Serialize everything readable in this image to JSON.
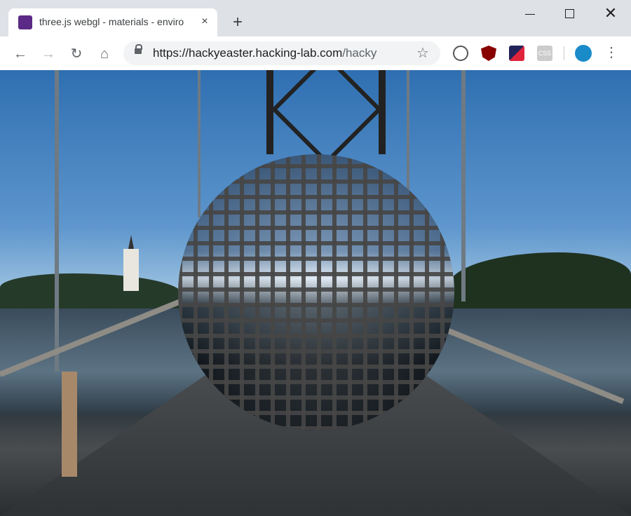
{
  "tab": {
    "title": "three.js webgl - materials - enviro",
    "close_label": "×"
  },
  "newtab_label": "+",
  "window": {
    "close_label": "✕"
  },
  "toolbar": {
    "back_icon": "←",
    "forward_icon": "→",
    "reload_icon": "↻",
    "home_icon": "⌂",
    "star_icon": "☆",
    "menu_icon": "⋮",
    "url_host": "https://hackyeaster.hacking-lab.com",
    "url_rest": "/hackye..."
  },
  "extensions": {
    "css_label": "CSS"
  }
}
